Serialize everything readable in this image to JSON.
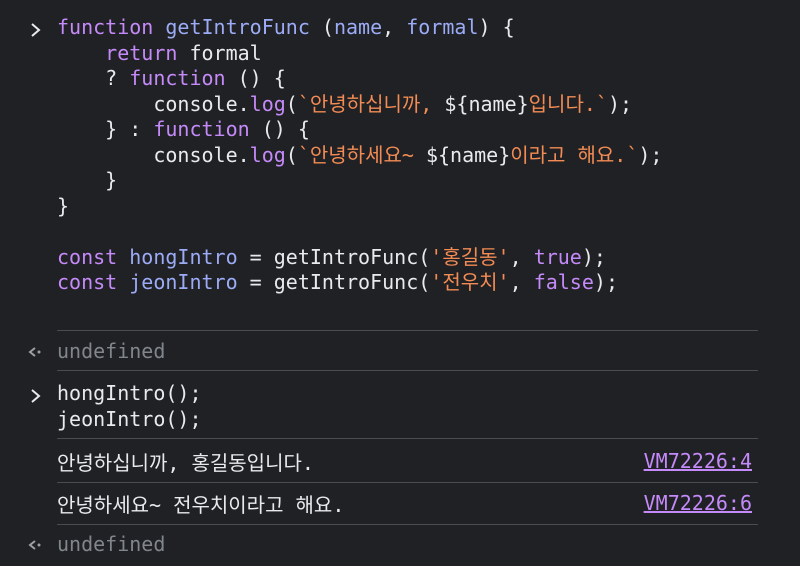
{
  "input_block": {
    "lines": [
      [
        {
          "t": "function",
          "c": "kw"
        },
        {
          "t": " "
        },
        {
          "t": "getIntroFunc",
          "c": "fn"
        },
        {
          "t": " ("
        },
        {
          "t": "name",
          "c": "param"
        },
        {
          "t": ", "
        },
        {
          "t": "formal",
          "c": "param"
        },
        {
          "t": ") {"
        }
      ],
      [
        {
          "t": "    "
        },
        {
          "t": "return",
          "c": "kw"
        },
        {
          "t": " formal"
        }
      ],
      [
        {
          "t": "    ? "
        },
        {
          "t": "function",
          "c": "kw"
        },
        {
          "t": " () {"
        }
      ],
      [
        {
          "t": "        console."
        },
        {
          "t": "log",
          "c": "kw"
        },
        {
          "t": "("
        },
        {
          "t": "`안녕하십니까, ",
          "c": "str"
        },
        {
          "t": "${name}"
        },
        {
          "t": "입니다.`",
          "c": "str"
        },
        {
          "t": ");"
        }
      ],
      [
        {
          "t": "    } : "
        },
        {
          "t": "function",
          "c": "kw"
        },
        {
          "t": " () {"
        }
      ],
      [
        {
          "t": "        console."
        },
        {
          "t": "log",
          "c": "kw"
        },
        {
          "t": "("
        },
        {
          "t": "`안녕하세요~ ",
          "c": "str"
        },
        {
          "t": "${name}"
        },
        {
          "t": "이라고 해요.`",
          "c": "str"
        },
        {
          "t": ");"
        }
      ],
      [
        {
          "t": "    }"
        }
      ],
      [
        {
          "t": "}"
        }
      ],
      [
        {
          "t": ""
        }
      ],
      [
        {
          "t": "const",
          "c": "kw"
        },
        {
          "t": " "
        },
        {
          "t": "hongIntro",
          "c": "var"
        },
        {
          "t": " = getIntroFunc("
        },
        {
          "t": "'홍길동'",
          "c": "str"
        },
        {
          "t": ", "
        },
        {
          "t": "true",
          "c": "kw"
        },
        {
          "t": ");"
        }
      ],
      [
        {
          "t": "const",
          "c": "kw"
        },
        {
          "t": " "
        },
        {
          "t": "jeonIntro",
          "c": "var"
        },
        {
          "t": " = getIntroFunc("
        },
        {
          "t": "'전우치'",
          "c": "str"
        },
        {
          "t": ", "
        },
        {
          "t": "false",
          "c": "kw"
        },
        {
          "t": ");"
        }
      ]
    ]
  },
  "result_1": "undefined",
  "second_input": {
    "lines": [
      "hongIntro();",
      "jeonIntro();"
    ]
  },
  "logs": [
    {
      "text": "안녕하십니까, 홍길동입니다.",
      "source": "VM72226:4"
    },
    {
      "text": "안녕하세요~ 전우치이라고 해요.",
      "source": "VM72226:6"
    }
  ],
  "result_2": "undefined",
  "icons": {
    "input_prompt": "chevron-right-icon",
    "result_prompt": "return-arrow-icon"
  },
  "colors": {
    "background": "#202124",
    "keyword": "#c58af9",
    "identifier": "#9cabf6",
    "string": "#f28b54",
    "muted": "#80868b",
    "link": "#c58af9"
  }
}
